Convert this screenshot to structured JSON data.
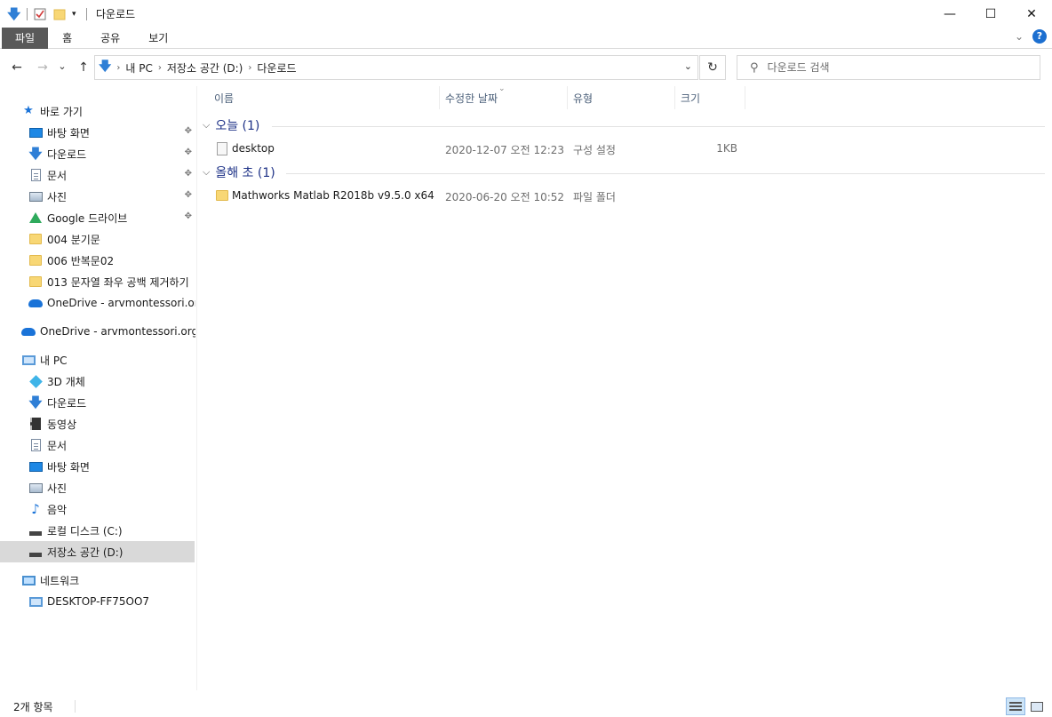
{
  "window": {
    "title": "다운로드",
    "qat_icons": [
      "down-arrow-icon",
      "properties-icon",
      "new-folder-icon",
      "customize-dropdown-icon"
    ],
    "controls": {
      "minimize": "—",
      "maximize": "☐",
      "close": "✕"
    }
  },
  "ribbon": {
    "tabs": [
      {
        "label": "파일",
        "active": true
      },
      {
        "label": "홈"
      },
      {
        "label": "공유"
      },
      {
        "label": "보기"
      }
    ],
    "expand_icon": "chevron-down-icon",
    "help_label": "?"
  },
  "navigation": {
    "back": "←",
    "forward": "→",
    "recent": "⌄",
    "up": "↑",
    "breadcrumb": [
      "내 PC",
      "저장소 공간 (D:)",
      "다운로드"
    ],
    "breadcrumb_sep": "›",
    "refresh": "↻",
    "search_placeholder": "다운로드 검색"
  },
  "sidebar": {
    "quick_access": {
      "label": "바로 가기",
      "items": [
        {
          "label": "바탕 화면",
          "icon": "desktop-icon",
          "pinned": true
        },
        {
          "label": "다운로드",
          "icon": "downloads-icon",
          "pinned": true
        },
        {
          "label": "문서",
          "icon": "documents-icon",
          "pinned": true
        },
        {
          "label": "사진",
          "icon": "pictures-icon",
          "pinned": true
        },
        {
          "label": "Google 드라이브",
          "icon": "google-drive-icon",
          "pinned": true
        },
        {
          "label": "004 분기문",
          "icon": "folder-icon"
        },
        {
          "label": "006 반복문02",
          "icon": "folder-icon"
        },
        {
          "label": "013 문자열 좌우 공백 제거하기",
          "icon": "folder-icon"
        },
        {
          "label": "OneDrive - arvmontessori.org",
          "icon": "onedrive-icon"
        }
      ]
    },
    "onedrive": {
      "label": "OneDrive - arvmontessori.org"
    },
    "this_pc": {
      "label": "내 PC",
      "items": [
        {
          "label": "3D 개체",
          "icon": "3d-objects-icon"
        },
        {
          "label": "다운로드",
          "icon": "downloads-icon"
        },
        {
          "label": "동영상",
          "icon": "videos-icon"
        },
        {
          "label": "문서",
          "icon": "documents-icon"
        },
        {
          "label": "바탕 화면",
          "icon": "desktop-icon"
        },
        {
          "label": "사진",
          "icon": "pictures-icon"
        },
        {
          "label": "음악",
          "icon": "music-icon"
        },
        {
          "label": "로컬 디스크 (C:)",
          "icon": "local-disk-icon"
        },
        {
          "label": "저장소 공간 (D:)",
          "icon": "storage-drive-icon",
          "selected": true
        }
      ]
    },
    "network": {
      "label": "네트워크",
      "items": [
        {
          "label": "DESKTOP-FF75OO7",
          "icon": "computer-icon"
        }
      ]
    },
    "pin_glyph": "📌"
  },
  "columns": [
    "이름",
    "수정한 날짜",
    "유형",
    "크기"
  ],
  "groups": [
    {
      "label": "오늘 (1)",
      "rows": [
        {
          "name": "desktop",
          "date": "2020-12-07 오전 12:23",
          "type": "구성 설정",
          "size": "1KB",
          "icon": "config-file-icon"
        }
      ]
    },
    {
      "label": "올해 초 (1)",
      "rows": [
        {
          "name": "Mathworks Matlab R2018b v9.5.0 x64 ...",
          "date": "2020-06-20 오전 10:52",
          "type": "파일 폴더",
          "size": "",
          "icon": "folder-icon"
        }
      ]
    }
  ],
  "status": {
    "item_count": "2개 항목",
    "views": [
      "details-view-icon",
      "large-icons-view-icon"
    ]
  }
}
